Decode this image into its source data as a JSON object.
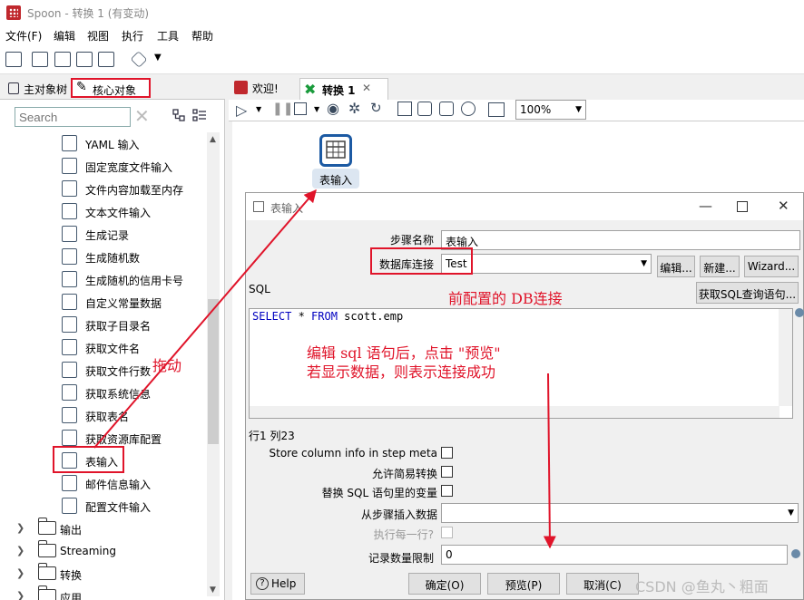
{
  "window": {
    "title": "Spoon - 转换 1 (有变动)"
  },
  "menu": [
    "文件(F)",
    "编辑",
    "视图",
    "执行",
    "工具",
    "帮助"
  ],
  "left_tabs": {
    "main_tree": "主对象树",
    "core_objects": "核心对象"
  },
  "search": {
    "placeholder": "Search"
  },
  "tree": {
    "steps": [
      "YAML 输入",
      "固定宽度文件输入",
      "文件内容加载至内存",
      "文本文件输入",
      "生成记录",
      "生成随机数",
      "生成随机的信用卡号",
      "自定义常量数据",
      "获取子目录名",
      "获取文件名",
      "获取文件行数",
      "获取系统信息",
      "获取表名",
      "获取资源库配置",
      "表输入",
      "邮件信息输入",
      "配置文件输入"
    ],
    "folders": [
      "输出",
      "Streaming",
      "转换",
      "应用"
    ]
  },
  "editor_tabs": {
    "welcome": "欢迎!",
    "transform": "转换 1"
  },
  "zoom": "100%",
  "canvas_step": {
    "label": "表输入"
  },
  "dialog": {
    "title": "表输入",
    "step_name_label": "步骤名称",
    "step_name_value": "表输入",
    "db_conn_label": "数据库连接",
    "db_conn_value": "Test",
    "edit_btn": "编辑...",
    "new_btn": "新建...",
    "wizard_btn": "Wizard...",
    "sql_label": "SQL",
    "get_sql_btn": "获取SQL查询语句...",
    "sql_keyword1": "SELECT",
    "sql_middle": " * ",
    "sql_keyword2": "FROM",
    "sql_rest": " scott.emp",
    "cursor_pos": "行1 列23",
    "store_col_info": "Store column info in step meta",
    "lazy_conv": "允许简易转换",
    "replace_vars": "替换 SQL 语句里的变量",
    "insert_from_step": "从步骤插入数据",
    "exec_each_row": "执行每一行?",
    "limit_label": "记录数量限制",
    "limit_value": "0",
    "help_btn": "Help",
    "ok_btn": "确定(O)",
    "preview_btn": "预览(P)",
    "cancel_btn": "取消(C)"
  },
  "annotations": {
    "drag": "拖动",
    "db_conn_note": "前配置的 DB连接",
    "sql_note_line1": "编辑 sql 语句后，点击 \"预览\"",
    "sql_note_line2": "若显示数据，则表示连接成功"
  },
  "watermark": "CSDN @鱼丸丶粗面",
  "colors": {
    "annotation_red": "#e0142a",
    "sql_keyword_blue": "#0000c0",
    "step_border_blue": "#1c5aa3"
  }
}
